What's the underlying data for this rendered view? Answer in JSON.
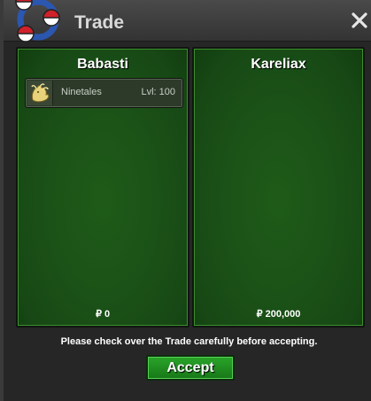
{
  "window": {
    "title": "Trade"
  },
  "icons": {
    "logo": "pokeball-logo-icon",
    "close": "close-icon",
    "item": "ninetales-icon"
  },
  "left_panel": {
    "player_name": "Babasti",
    "items": [
      {
        "name": "Ninetales",
        "level": "Lvl: 100"
      }
    ],
    "currency_symbol": "₽",
    "money": "0"
  },
  "right_panel": {
    "player_name": "Kareliax",
    "items": [],
    "currency_symbol": "₽",
    "money": "200,000"
  },
  "footer": {
    "notice": "Please check over the Trade carefully before accepting.",
    "accept_label": "Accept"
  },
  "colors": {
    "panel_green": "#1b5217",
    "accept_green": "#22962a",
    "titlebar": "#3d3d3d"
  }
}
